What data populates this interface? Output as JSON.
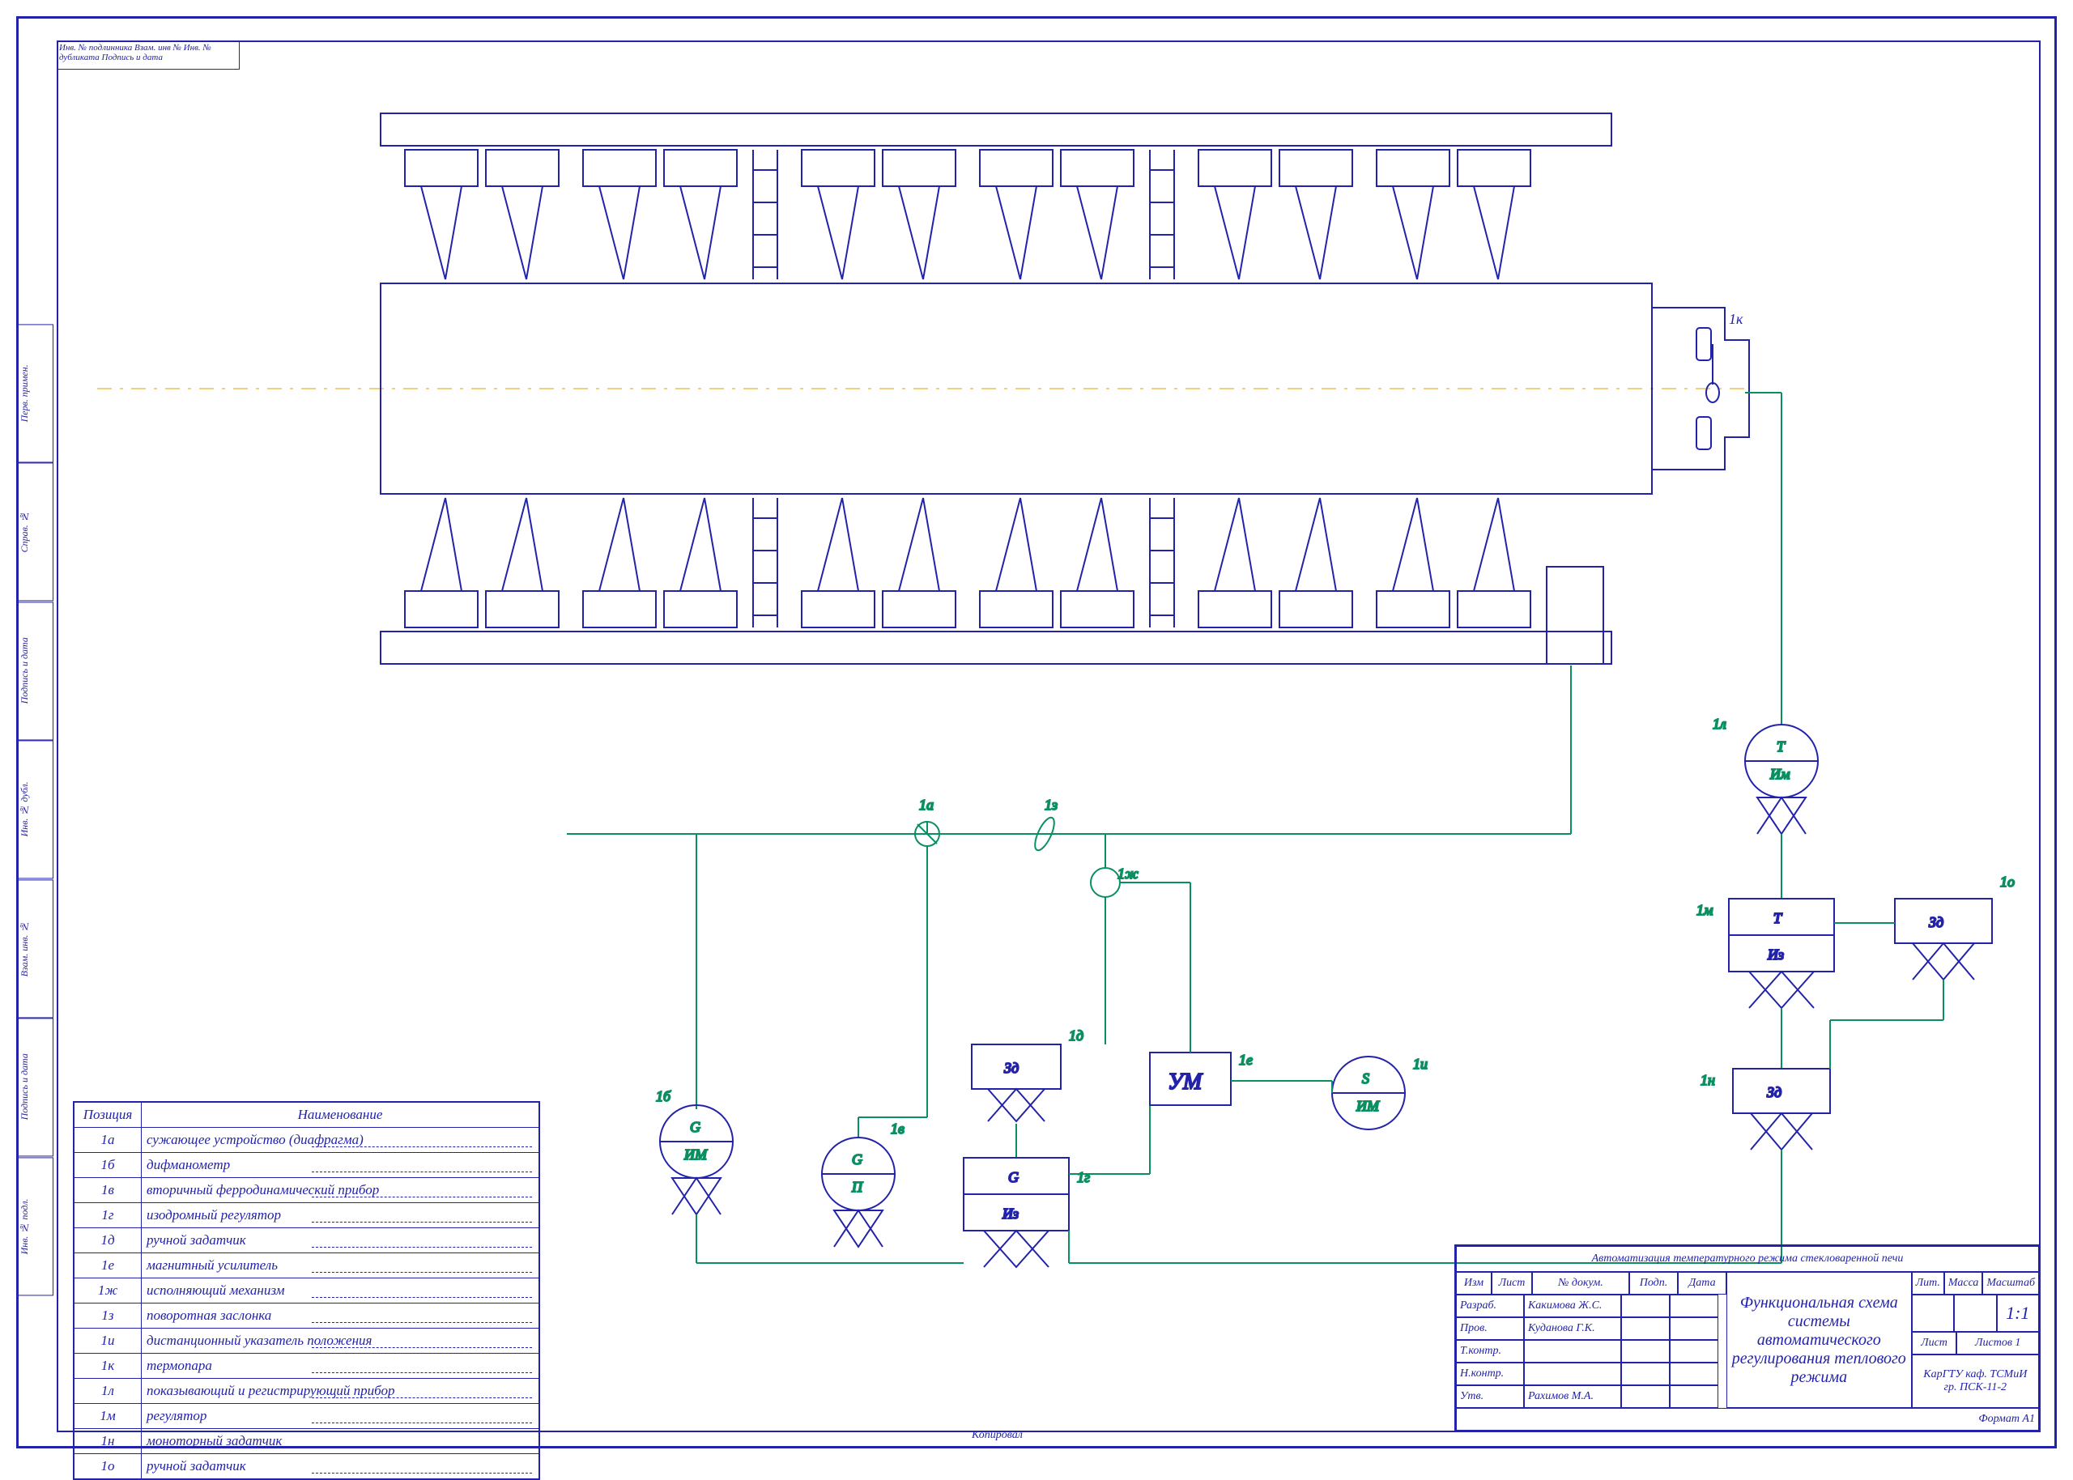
{
  "legend": {
    "headers": {
      "pos": "Позиция",
      "name": "Наименование"
    },
    "rows": [
      {
        "pos": "1а",
        "name": "сужающее устройство (диафрагма)"
      },
      {
        "pos": "1б",
        "name": "дифманометр"
      },
      {
        "pos": "1в",
        "name": "вторичный ферродинамический прибор"
      },
      {
        "pos": "1г",
        "name": "изодромный регулятор"
      },
      {
        "pos": "1д",
        "name": "ручной задатчик"
      },
      {
        "pos": "1е",
        "name": "магнитный усилитель"
      },
      {
        "pos": "1ж",
        "name": "исполняющий механизм"
      },
      {
        "pos": "1з",
        "name": "поворотная заслонка"
      },
      {
        "pos": "1и",
        "name": "дистанционный указатель положения"
      },
      {
        "pos": "1к",
        "name": "термопара"
      },
      {
        "pos": "1л",
        "name": "показывающий и регистрирующий прибор"
      },
      {
        "pos": "1м",
        "name": "регулятор"
      },
      {
        "pos": "1н",
        "name": "моноторный задатчик"
      },
      {
        "pos": "1о",
        "name": "ручной задатчик"
      }
    ]
  },
  "title_block": {
    "top_title": "Автоматизация температурного режима стекловаренной печи",
    "sub_title": "Функциональная схема системы автоматического регулирования теплового режима",
    "headers": [
      "Изм",
      "Лист",
      "№ докум.",
      "Подп.",
      "Дата"
    ],
    "rows": [
      {
        "role": "Разраб.",
        "name": "Какимова Ж.С."
      },
      {
        "role": "Пров.",
        "name": "Куданова Г.К."
      },
      {
        "role": "Т.контр.",
        "name": ""
      },
      {
        "role": "Н.контр.",
        "name": ""
      },
      {
        "role": "Утв.",
        "name": "Рахимов М.А."
      }
    ],
    "right": {
      "lit": "Лит.",
      "massa": "Масса",
      "scale": "Масштаб",
      "scale_val": "1:1",
      "sheet": "Лист",
      "sheets": "Листов",
      "sheets_val": "1",
      "org": "КарГТУ каф. ТСМиИ\nгр. ПСК-11-2",
      "format": "Формат   A1"
    }
  },
  "foot": "Копировал",
  "toptab": "Инв. № подлинника Взам. инв № Инв. № дубликата Подпись и дата",
  "sidetabs": [
    "Перв. примен.",
    "Справ. №",
    "Подпись и дата",
    "Инв. № дубл.",
    "Взам. инв. №",
    "Подпись и дата",
    "Инв. № подл."
  ],
  "diagram_labels": {
    "1a": "1а",
    "1b": "1б",
    "1v": "1в",
    "1g": "1г",
    "1d": "1д",
    "1e": "1е",
    "1zh": "1ж",
    "1z": "1з",
    "1i": "1и",
    "1k": "1к",
    "1l": "1л",
    "1m": "1м",
    "1n": "1н",
    "1o": "1о",
    "um": "УМ",
    "G": "G",
    "G_IM": "ИМ",
    "G_P": "П",
    "G_Iz": "Из",
    "Zd": "Зд",
    "S": "S",
    "S_IM": "ИМ",
    "T": "T",
    "T_IM": "Им",
    "T_Iz": "Из"
  }
}
